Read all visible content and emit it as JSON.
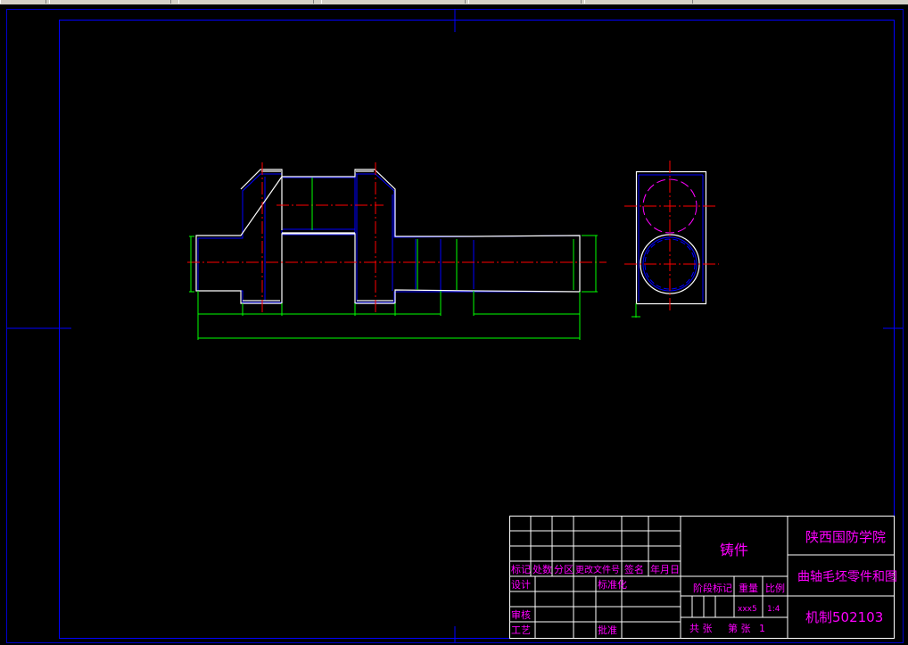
{
  "title_block": {
    "material": "铸件",
    "school": "陕西国防学院",
    "drawing_title": "曲轴毛坯零件和图",
    "drawing_number": "机制502103",
    "headers": {
      "mark": "标记",
      "count": "处数",
      "zone": "分区",
      "change_doc": "更改文件号",
      "signature": "签名",
      "date": "年月日"
    },
    "roles": {
      "design": "设计",
      "standardize": "标准化",
      "review": "审核",
      "process": "工艺",
      "approve": "批准"
    },
    "stage_mark": "阶段标记",
    "weight": "重量",
    "scale": "比例",
    "weight_value": "xxx5",
    "scale_value": "1:4",
    "sheets_total": "共   张",
    "sheet_current": "第   张",
    "sheet_no": "1"
  },
  "colors": {
    "background": "#000000",
    "frame": "#0000ff",
    "outline": "#ffffff",
    "centerline": "#ff0000",
    "dimension": "#00ff00",
    "hidden_line": "#0000ff",
    "circle": "#ff00ff",
    "text": "#ff00ff"
  }
}
